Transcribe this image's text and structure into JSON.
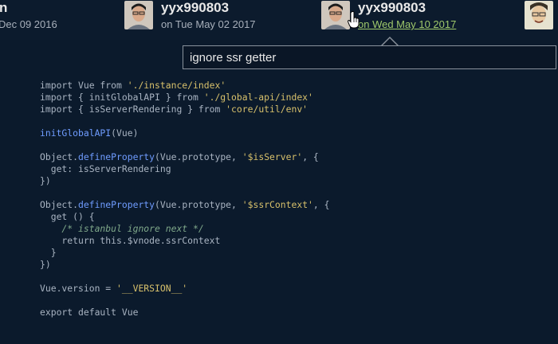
{
  "colors": {
    "background": "#0b1a2c",
    "active_date": "#9fc96b",
    "string": "#d7c06b",
    "function": "#6f9cff",
    "comment": "#7fa88a"
  },
  "timeline": {
    "commits": [
      {
        "author": "n",
        "date": "Dec 09 2016"
      },
      {
        "author": "yyx990803",
        "date": "on Tue May 02 2017"
      },
      {
        "author": "yyx990803",
        "date": "on Wed May 10 2017"
      },
      {
        "author": "",
        "date": ""
      }
    ]
  },
  "tooltip": {
    "message": "ignore ssr getter"
  },
  "code": {
    "lines": [
      [
        {
          "t": "import Vue from ",
          "c": "kw"
        },
        {
          "t": "'./instance/index'",
          "c": "str"
        }
      ],
      [
        {
          "t": "import { initGlobalAPI } from ",
          "c": "kw"
        },
        {
          "t": "'./global-api/index'",
          "c": "str"
        }
      ],
      [
        {
          "t": "import { isServerRendering } from ",
          "c": "kw"
        },
        {
          "t": "'core/util/env'",
          "c": "str"
        }
      ],
      [],
      [
        {
          "t": "initGlobalAPI",
          "c": "fn"
        },
        {
          "t": "(Vue)",
          "c": "kw"
        }
      ],
      [],
      [
        {
          "t": "Object.",
          "c": "kw"
        },
        {
          "t": "defineProperty",
          "c": "fn"
        },
        {
          "t": "(Vue.prototype, ",
          "c": "kw"
        },
        {
          "t": "'$isServer'",
          "c": "str"
        },
        {
          "t": ", {",
          "c": "kw"
        }
      ],
      [
        {
          "t": "  get: isServerRendering",
          "c": "kw"
        }
      ],
      [
        {
          "t": "})",
          "c": "kw"
        }
      ],
      [],
      [
        {
          "t": "Object.",
          "c": "kw"
        },
        {
          "t": "defineProperty",
          "c": "fn"
        },
        {
          "t": "(Vue.prototype, ",
          "c": "kw"
        },
        {
          "t": "'$ssrContext'",
          "c": "str"
        },
        {
          "t": ", {",
          "c": "kw"
        }
      ],
      [
        {
          "t": "  get () {",
          "c": "kw"
        }
      ],
      [
        {
          "t": "    /* istanbul ignore next */",
          "c": "cm"
        }
      ],
      [
        {
          "t": "    return this.$vnode.ssrContext",
          "c": "kw"
        }
      ],
      [
        {
          "t": "  }",
          "c": "kw"
        }
      ],
      [
        {
          "t": "})",
          "c": "kw"
        }
      ],
      [],
      [
        {
          "t": "Vue.version = ",
          "c": "kw"
        },
        {
          "t": "'__VERSION__'",
          "c": "str"
        }
      ],
      [],
      [
        {
          "t": "export default Vue",
          "c": "kw"
        }
      ]
    ]
  }
}
